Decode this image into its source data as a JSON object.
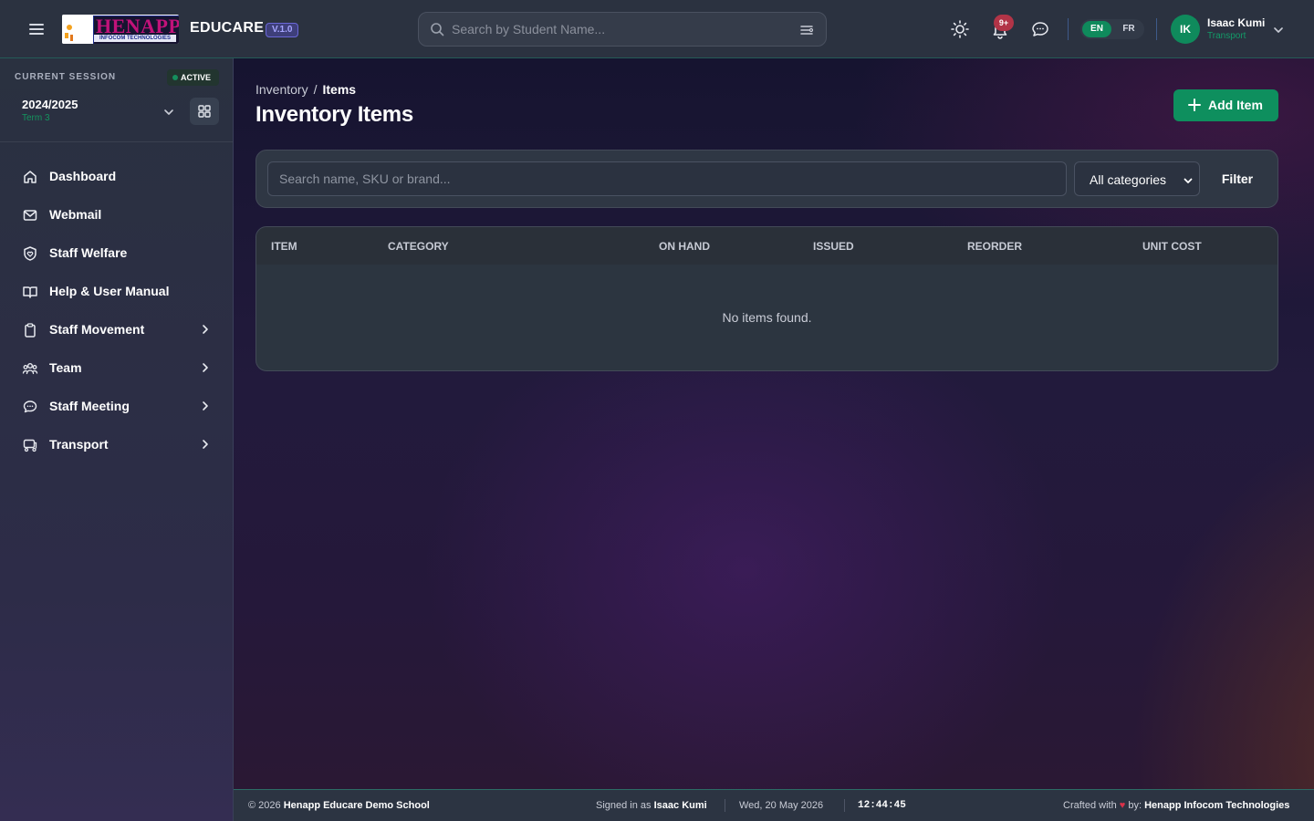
{
  "header": {
    "logo_main": "HENAPP",
    "logo_sub": "INFOCOM TECHNOLOGIES",
    "brand": "EDUCARE",
    "version": "V.1.0",
    "search_placeholder": "Search by Student Name...",
    "notifications_badge": "9+",
    "lang_en": "EN",
    "lang_fr": "FR",
    "user_initials": "IK",
    "user_name": "Isaac Kumi",
    "user_role": "Transport"
  },
  "session": {
    "label": "CURRENT SESSION",
    "status": "ACTIVE",
    "year": "2024/2025",
    "term": "Term 3"
  },
  "sidebar": {
    "items": [
      {
        "label": "Dashboard",
        "icon": "home-icon",
        "has_children": false
      },
      {
        "label": "Webmail",
        "icon": "mail-icon",
        "has_children": false
      },
      {
        "label": "Staff Welfare",
        "icon": "shield-heart-icon",
        "has_children": false
      },
      {
        "label": "Help & User Manual",
        "icon": "book-icon",
        "has_children": false
      },
      {
        "label": "Staff Movement",
        "icon": "clipboard-icon",
        "has_children": true
      },
      {
        "label": "Team",
        "icon": "users-icon",
        "has_children": true
      },
      {
        "label": "Staff Meeting",
        "icon": "chat-icon",
        "has_children": true
      },
      {
        "label": "Transport",
        "icon": "route-icon",
        "has_children": true
      }
    ]
  },
  "page": {
    "breadcrumb_parent": "Inventory",
    "breadcrumb_sep": "/",
    "breadcrumb_current": "Items",
    "title": "Inventory Items",
    "add_button": "Add Item"
  },
  "filters": {
    "search_placeholder": "Search name, SKU or brand...",
    "category_value": "All categories",
    "filter_button": "Filter"
  },
  "table": {
    "columns": [
      "ITEM",
      "CATEGORY",
      "ON HAND",
      "ISSUED",
      "REORDER",
      "UNIT COST"
    ],
    "empty_message": "No items found."
  },
  "footer": {
    "copyright": "© 2026",
    "school": "Henapp Educare Demo School",
    "signed_in_prefix": "Signed in as",
    "signed_in_user": "Isaac Kumi",
    "date": "Wed, 20 May 2026",
    "time": "12:44:45",
    "crafted_prefix": "Crafted with",
    "crafted_by": "by:",
    "company": "Henapp Infocom Technologies"
  },
  "colors": {
    "accent_green": "#0e8f5e",
    "topbar_bg": "#2b3240",
    "badge_red": "#b23447",
    "version_purple": "#6a67d8"
  }
}
